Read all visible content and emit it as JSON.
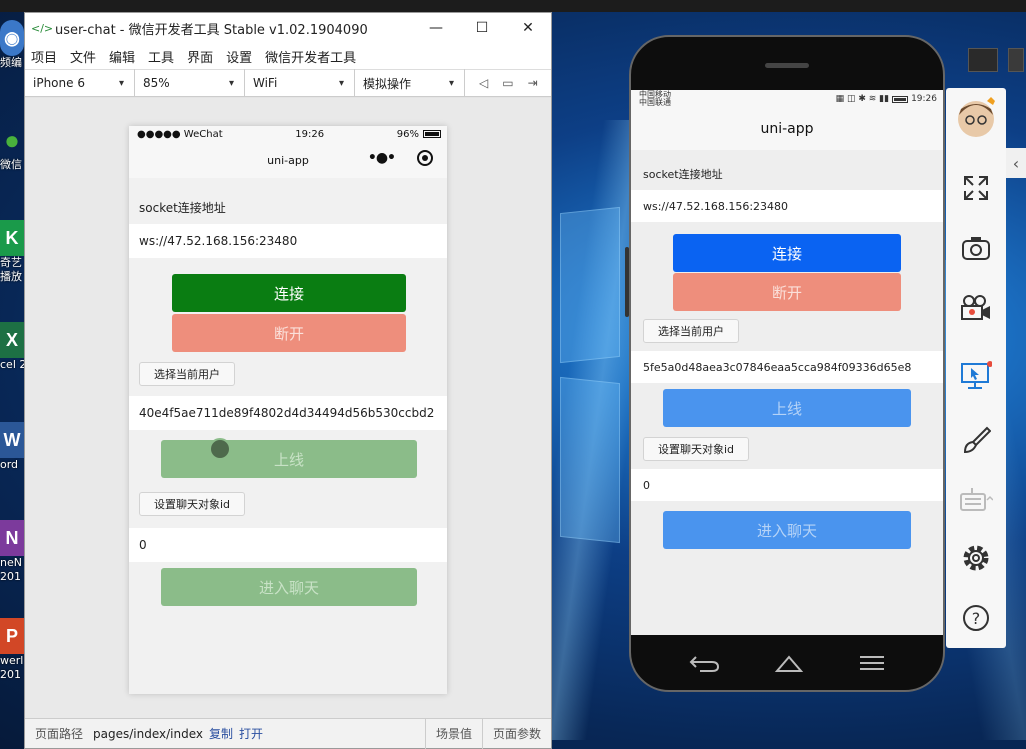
{
  "devtools": {
    "title": "user-chat - 微信开发者工具 Stable v1.02.1904090",
    "menu": [
      "项目",
      "文件",
      "编辑",
      "工具",
      "界面",
      "设置",
      "微信开发者工具"
    ],
    "toolbar": {
      "device": "iPhone 6",
      "zoom": "85%",
      "network": "WiFi",
      "operation": "模拟操作"
    },
    "footer": {
      "path_label": "页面路径",
      "path": "pages/index/index",
      "copy": "复制",
      "open": "打开",
      "scene": "场景值",
      "params": "页面参数"
    }
  },
  "desktop_icons": [
    {
      "label": "频编",
      "glyph": "◉",
      "color": "#3b78c8"
    },
    {
      "label": "微信",
      "glyph": "●",
      "color": "#49b23c"
    },
    {
      "label": "奇艺\n播放",
      "glyph": "K",
      "color": "#1a9a4a"
    },
    {
      "label": "cel 2",
      "glyph": "X",
      "color": "#1d7044"
    },
    {
      "label": "ord",
      "glyph": "W",
      "color": "#2b5797"
    },
    {
      "label": "neN\n201",
      "glyph": "N",
      "color": "#7c3a9c"
    },
    {
      "label": "werl\n201",
      "glyph": "P",
      "color": "#d24726"
    }
  ],
  "sim": {
    "status": {
      "carrier": "●●●●● WeChat",
      "time": "19:26",
      "battery": "96%"
    },
    "nav_title": "uni-app",
    "socket_label": "socket连接地址",
    "socket_url": "ws://47.52.168.156:23480",
    "connect_label": "连接",
    "disconnect_label": "断开",
    "select_user_label": "选择当前用户",
    "user_id": "40e4f5ae711de89f4802d4d34494d56b530ccbd2",
    "online_label": "上线",
    "set_chat_label": "设置聊天对象id",
    "chat_target": "0",
    "enter_chat_label": "进入聊天",
    "colors": {
      "connect": "#0a7d12",
      "disconnect": "#ee8e7c",
      "online": "#8bbc89",
      "enter": "#8bbc89"
    }
  },
  "android": {
    "status": {
      "left": "中国移动 中国联通",
      "time": "19:26"
    },
    "nav_title": "uni-app",
    "socket_label": "socket连接地址",
    "socket_url": "ws://47.52.168.156:23480",
    "connect_label": "连接",
    "disconnect_label": "断开",
    "select_user_label": "选择当前用户",
    "user_id": "5fe5a0d48aea3c07846eaa5cca984f09336d65e8",
    "online_label": "上线",
    "set_chat_label": "设置聊天对象id",
    "chat_target": "0",
    "enter_chat_label": "进入聊天",
    "colors": {
      "connect": "#0a63f2",
      "disconnect": "#ee8e7c",
      "online": "#4a94ee",
      "enter": "#4a94ee"
    }
  },
  "side_tools": [
    "avatar",
    "fullscreen-icon",
    "screenshot-camera-icon",
    "video-record-icon",
    "screen-cast-icon",
    "brush-icon",
    "keyboard-icon",
    "settings-gear-icon",
    "help-icon"
  ]
}
